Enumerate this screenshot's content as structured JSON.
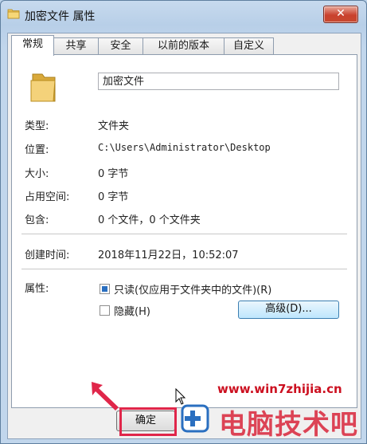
{
  "window": {
    "title": "加密文件 属性",
    "close_glyph": "✕"
  },
  "tabs": [
    {
      "label": "常规",
      "active": true
    },
    {
      "label": "共享",
      "active": false
    },
    {
      "label": "安全",
      "active": false
    },
    {
      "label": "以前的版本",
      "active": false
    },
    {
      "label": "自定义",
      "active": false
    }
  ],
  "general": {
    "folder_name": "加密文件",
    "type_label": "类型:",
    "type_value": "文件夹",
    "location_label": "位置:",
    "location_value": "C:\\Users\\Administrator\\Desktop",
    "size_label": "大小:",
    "size_value": "0 字节",
    "size_on_disk_label": "占用空间:",
    "size_on_disk_value": "0 字节",
    "contains_label": "包含:",
    "contains_value": "0 个文件，0 个文件夹",
    "created_label": "创建时间:",
    "created_value": "2018年11月22日，10:52:07",
    "attributes_label": "属性:",
    "readonly_label": "只读(仅应用于文件夹中的文件)(R)",
    "readonly_checked": true,
    "hidden_label": "隐藏(H)",
    "hidden_checked": false,
    "advanced_label": "高级(D)..."
  },
  "buttons": {
    "ok_label": "确定"
  },
  "watermark": {
    "url": "www.win7zhijia.cn",
    "logo_text": "电脑技术吧"
  },
  "icons": {
    "title": "folder-icon",
    "big": "folder-icon",
    "cursor": "mouse-pointer-icon",
    "arrow": "red-arrow-icon"
  },
  "colors": {
    "highlight": "#e0264a",
    "accent": "#2a6fc0"
  }
}
